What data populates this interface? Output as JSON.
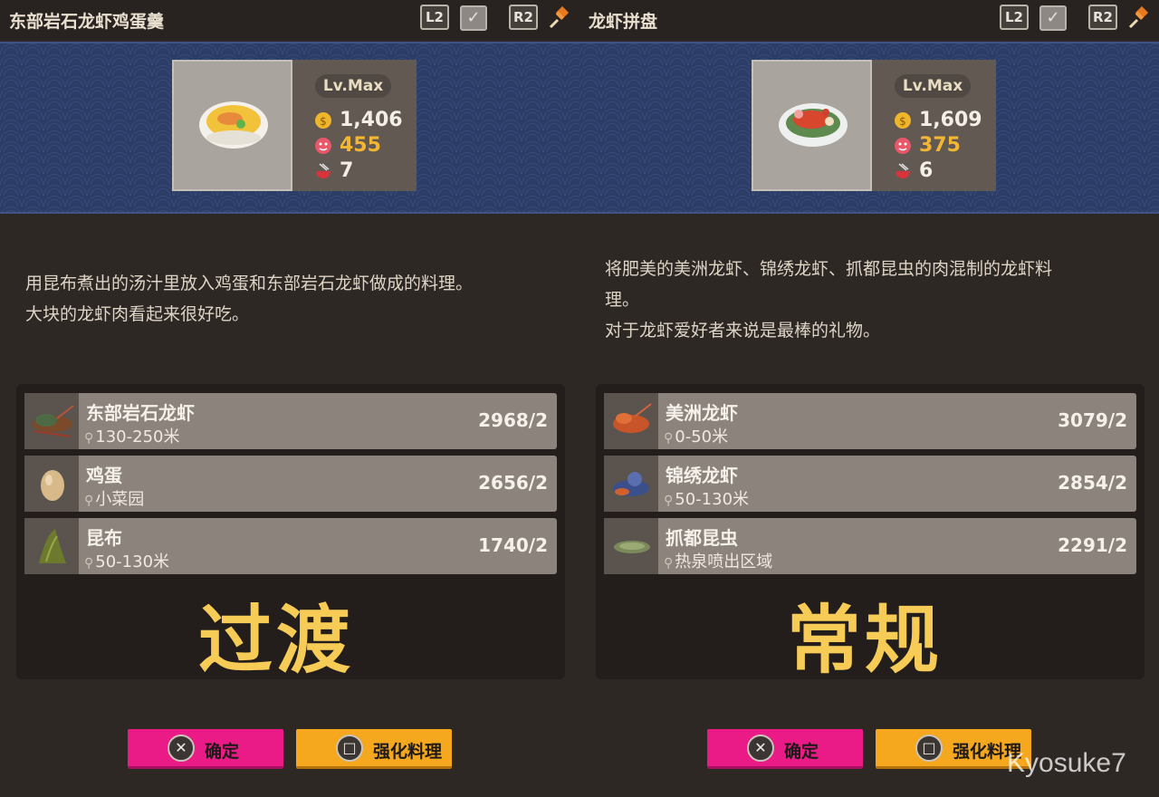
{
  "panels": [
    {
      "title": "东部岩石龙虾鸡蛋羹",
      "l2": "L2",
      "r2": "R2",
      "level": "Lv.Max",
      "price": "1,406",
      "taste": "455",
      "servings": "7",
      "description": [
        "用昆布煮出的汤汁里放入鸡蛋和东部岩石龙虾做成的料理。",
        "大块的龙虾肉看起来很好吃。"
      ],
      "ingredients": [
        {
          "name": "东部岩石龙虾",
          "location": "130-250米",
          "qty": "2968/2"
        },
        {
          "name": "鸡蛋",
          "location": "小菜园",
          "qty": "2656/2"
        },
        {
          "name": "昆布",
          "location": "50-130米",
          "qty": "1740/2"
        }
      ],
      "overlay": "过渡",
      "confirm": "确定",
      "enhance": "强化料理"
    },
    {
      "title": "龙虾拼盘",
      "l2": "L2",
      "r2": "R2",
      "level": "Lv.Max",
      "price": "1,609",
      "taste": "375",
      "servings": "6",
      "description": [
        "将肥美的美洲龙虾、锦绣龙虾、抓都昆虫的肉混制的龙虾料",
        "理。",
        "对于龙虾爱好者来说是最棒的礼物。"
      ],
      "ingredients": [
        {
          "name": "美洲龙虾",
          "location": "0-50米",
          "qty": "3079/2"
        },
        {
          "name": "锦绣龙虾",
          "location": "50-130米",
          "qty": "2854/2"
        },
        {
          "name": "抓都昆虫",
          "location": "热泉喷出区域",
          "qty": "2291/2"
        }
      ],
      "overlay": "常规",
      "confirm": "确定",
      "enhance": "强化料理"
    }
  ],
  "watermark": "Kyosuke7",
  "colors": {
    "confirm": "#ea1a86",
    "enhance": "#f5a71e",
    "overlay": "#f6cb56",
    "taste": "#f2b632"
  }
}
